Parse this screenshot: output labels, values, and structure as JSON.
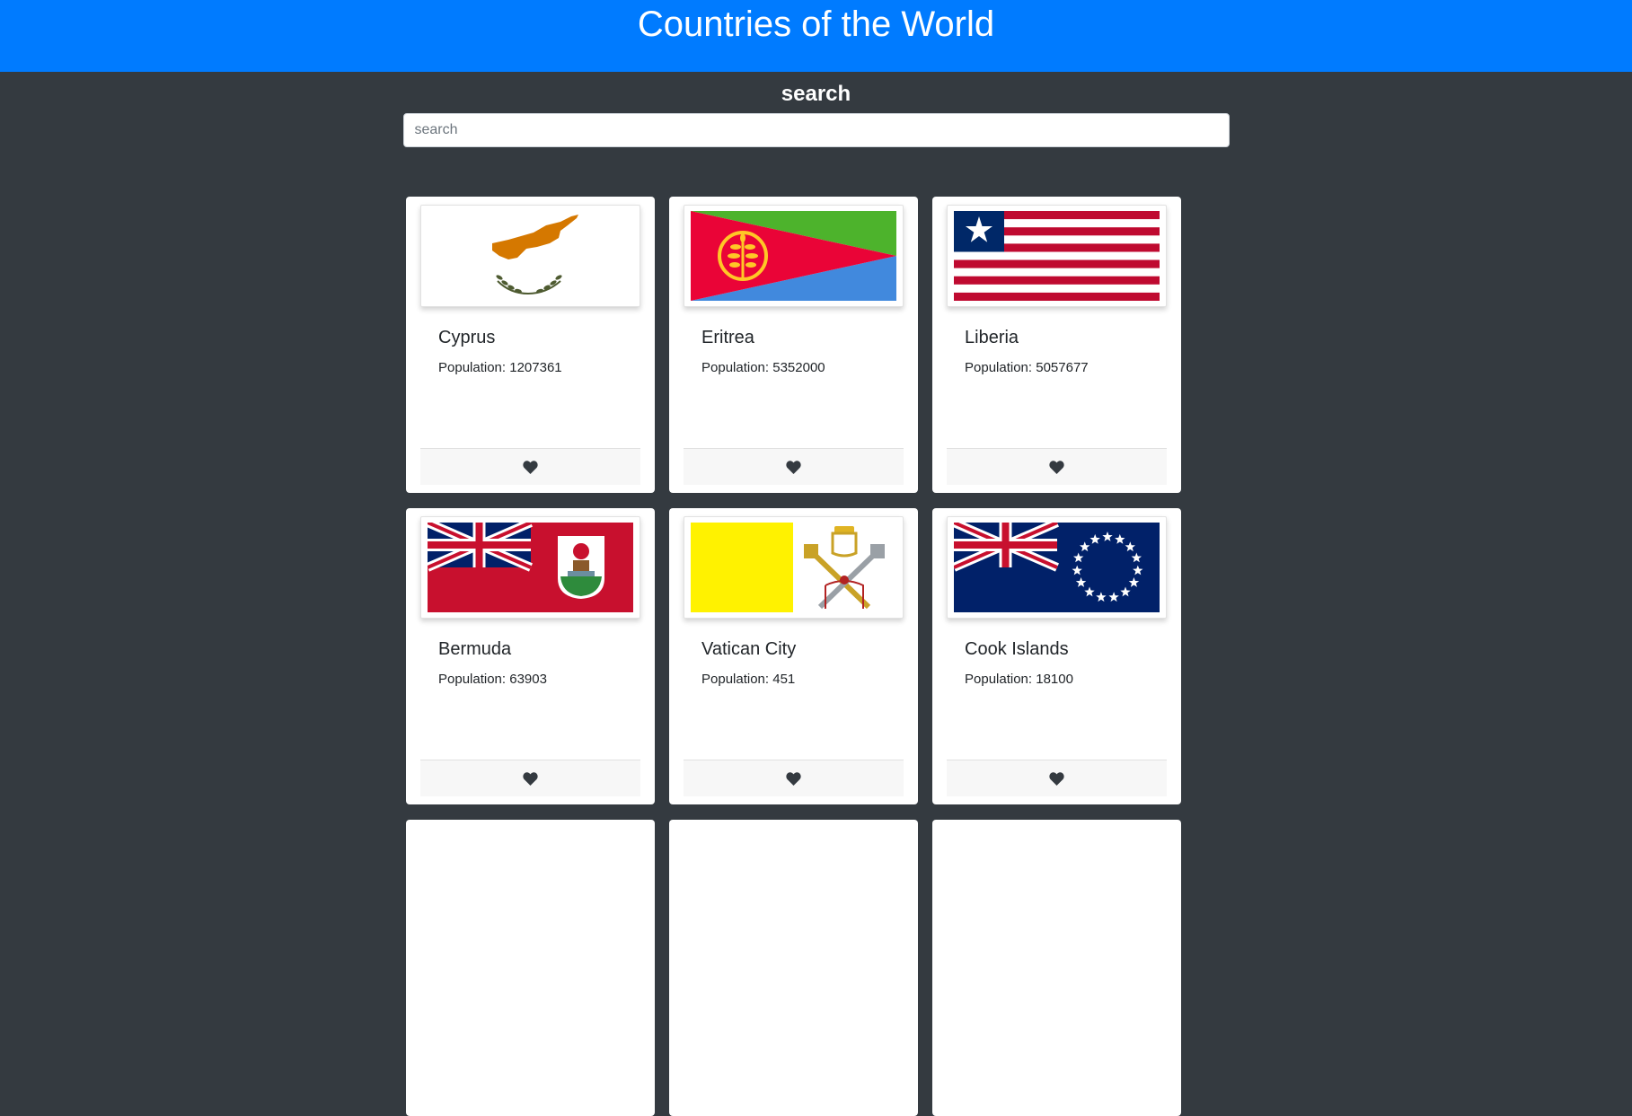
{
  "header": {
    "title": "Countries of the World"
  },
  "search": {
    "title": "search",
    "placeholder": "search",
    "value": ""
  },
  "colors": {
    "header_bg": "#007bff",
    "page_bg": "#343a40",
    "heart": "#343a40"
  },
  "countries": [
    {
      "name": "Cyprus",
      "population_text": "Population: 1207361",
      "flag": "cyprus-flag-icon"
    },
    {
      "name": "Eritrea",
      "population_text": "Population: 5352000",
      "flag": "eritrea-flag-icon"
    },
    {
      "name": "Liberia",
      "population_text": "Population: 5057677",
      "flag": "liberia-flag-icon"
    },
    {
      "name": "Bermuda",
      "population_text": "Population: 63903",
      "flag": "bermuda-flag-icon"
    },
    {
      "name": "Vatican City",
      "population_text": "Population: 451",
      "flag": "vatican-flag-icon"
    },
    {
      "name": "Cook Islands",
      "population_text": "Population: 18100",
      "flag": "cook-islands-flag-icon"
    }
  ],
  "favorite_icon": "heart-icon"
}
